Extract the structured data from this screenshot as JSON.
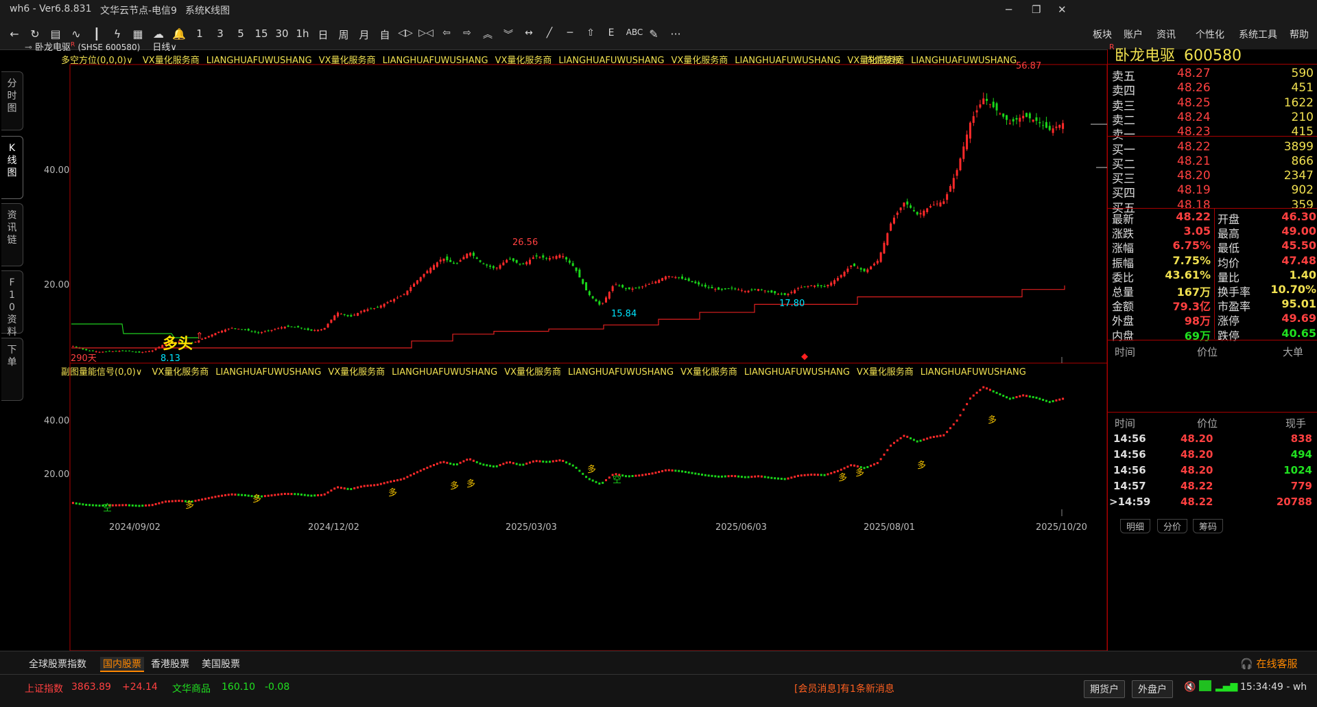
{
  "title_bar": {
    "app": "wh6  -  Ver6.8.831",
    "server": "文华云节点-电信9",
    "view": "系统K线图"
  },
  "toolbar": {
    "icons": [
      "back-icon",
      "refresh-icon",
      "list-icon",
      "line-chart-icon",
      "candlestick-icon",
      "lightning-icon",
      "grid-icon",
      "cloud-icon",
      "bell-icon"
    ],
    "periods": [
      "1",
      "3",
      "5",
      "15",
      "30",
      "1h",
      "日",
      "周",
      "月",
      "自"
    ],
    "right_menu": [
      "板块",
      "账户",
      "资讯",
      "个性化",
      "系统工具",
      "帮助"
    ],
    "draw_icons": [
      "compress-icon",
      "expand-icon",
      "left-arrow-icon",
      "right-arrow-icon",
      "up-double-icon",
      "down-double-icon",
      "fit-icon",
      "line-draw-icon",
      "hline-icon",
      "home-icon",
      "text-e-icon"
    ],
    "abc_label": "ABC",
    "more_label": "···"
  },
  "left_tabs": [
    {
      "label": "分时图",
      "active": false
    },
    {
      "label": "K线图",
      "active": true
    },
    {
      "label": "资讯链",
      "active": false
    },
    {
      "label": "F10资料",
      "active": false
    },
    {
      "label": "下单",
      "active": false
    }
  ],
  "chart_header": {
    "symbol": "卧龙电驱",
    "r_mark": "R",
    "code": "(SHSE 600580)",
    "period": "日线∨"
  },
  "main_panel": {
    "indicator": "多空方位(0,0,0)∨",
    "ads": [
      "VX量化服务商",
      "LIANGHUAFUWUSHANG",
      "VX量化服务商",
      "LIANGHUAFUWUSHANG",
      "VX量化服务商",
      "LIANGHUAFUWUSHANG",
      "VX量化服务商",
      "LIANGHUAFUWUSHANG",
      "VX量化服务商",
      "LIANGHUAFUWUSHANG"
    ],
    "adjust": "向前复权",
    "y_ticks": [
      "40.00",
      "20.00"
    ],
    "annotations": {
      "high": "56.87",
      "mid_high": "26.56",
      "low1": "8.13",
      "low2": "15.84",
      "low3": "17.80",
      "days": "290天",
      "signal": "多头"
    }
  },
  "sub_panel": {
    "indicator": "副图量能信号(0,0)∨",
    "ads": [
      "VX量化服务商",
      "LIANGHUAFUWUSHANG",
      "VX量化服务商",
      "LIANGHUAFUWUSHANG",
      "VX量化服务商",
      "LIANGHUAFUWUSHANG",
      "VX量化服务商",
      "LIANGHUAFUWUSHANG",
      "VX量化服务商",
      "LIANGHUAFUWUSHANG"
    ],
    "y_ticks": [
      "40.00",
      "20.00"
    ],
    "signals": {
      "bull": "多",
      "bear": "空"
    }
  },
  "x_axis": [
    "2024/09/02",
    "2024/12/02",
    "2025/03/03",
    "2025/06/03",
    "2025/08/01",
    "2025/10/20"
  ],
  "chart_data": {
    "type": "candlestick",
    "x_ticks": [
      "2024/09/02",
      "2024/12/02",
      "2025/03/03",
      "2025/06/03",
      "2025/08/01",
      "2025/10/20"
    ],
    "y_ticks": [
      20.0,
      40.0
    ],
    "labeled_points": [
      {
        "label": "8.13",
        "value": 8.13
      },
      {
        "label": "26.56",
        "value": 26.56
      },
      {
        "label": "15.84",
        "value": 15.84
      },
      {
        "label": "17.80",
        "value": 17.8
      },
      {
        "label": "56.87",
        "value": 56.87
      }
    ],
    "close_path": [
      9.3,
      8.6,
      8.3,
      8.4,
      8.5,
      8.2,
      8.5,
      9.8,
      10.1,
      9.8,
      10.8,
      11.8,
      12.5,
      12.2,
      11.6,
      12.1,
      12.7,
      12.6,
      12.0,
      12.3,
      15.2,
      14.4,
      15.6,
      16.0,
      17.2,
      18.2,
      20.6,
      22.8,
      24.7,
      23.5,
      25.8,
      23.7,
      22.8,
      24.6,
      23.4,
      25.0,
      24.6,
      25.3,
      23.0,
      18.5,
      16.3,
      20.2,
      19.2,
      19.6,
      20.4,
      21.6,
      21.2,
      20.4,
      19.6,
      19.1,
      19.4,
      18.9,
      19.3,
      18.6,
      18.2,
      19.5,
      19.9,
      19.7,
      21.3,
      23.5,
      22.3,
      24.3,
      31.0,
      34.5,
      32.2,
      33.8,
      34.6,
      40.2,
      48.5,
      52.6,
      50.4,
      48.2,
      49.5,
      48.6,
      47.0,
      48.22
    ],
    "current_price": 48.22
  },
  "quote": {
    "name": "卧龙电驱",
    "code": "600580",
    "asks": [
      {
        "label": "卖五",
        "price": "48.27",
        "vol": "590"
      },
      {
        "label": "卖四",
        "price": "48.26",
        "vol": "451"
      },
      {
        "label": "卖三",
        "price": "48.25",
        "vol": "1622"
      },
      {
        "label": "卖二",
        "price": "48.24",
        "vol": "210"
      },
      {
        "label": "卖一",
        "price": "48.23",
        "vol": "415"
      }
    ],
    "bids": [
      {
        "label": "买一",
        "price": "48.22",
        "vol": "3899"
      },
      {
        "label": "买二",
        "price": "48.21",
        "vol": "866"
      },
      {
        "label": "买三",
        "price": "48.20",
        "vol": "2347"
      },
      {
        "label": "买四",
        "price": "48.19",
        "vol": "902"
      },
      {
        "label": "买五",
        "price": "48.18",
        "vol": "359"
      }
    ],
    "stats_left": [
      {
        "label": "最新",
        "value": "48.22",
        "color": "red"
      },
      {
        "label": "涨跌",
        "value": "3.05",
        "color": "red"
      },
      {
        "label": "涨幅",
        "value": "6.75%",
        "color": "red"
      },
      {
        "label": "振幅",
        "value": "7.75%",
        "color": "yellow"
      },
      {
        "label": "委比",
        "value": "43.61%",
        "color": "yellow"
      },
      {
        "label": "总量",
        "value": "167万",
        "color": "yellow"
      },
      {
        "label": "金额",
        "value": "79.3亿",
        "color": "red"
      },
      {
        "label": "外盘",
        "value": "98万",
        "color": "red"
      },
      {
        "label": "内盘",
        "value": "69万",
        "color": "green"
      }
    ],
    "stats_right": [
      {
        "label": "开盘",
        "value": "46.30",
        "color": "red"
      },
      {
        "label": "最高",
        "value": "49.00",
        "color": "red"
      },
      {
        "label": "最低",
        "value": "45.50",
        "color": "red"
      },
      {
        "label": "均价",
        "value": "47.48",
        "color": "red"
      },
      {
        "label": "量比",
        "value": "1.40",
        "color": "yellow"
      },
      {
        "label": "换手率",
        "value": "10.70%",
        "color": "yellow"
      },
      {
        "label": "市盈率",
        "value": "95.01",
        "color": "yellow"
      },
      {
        "label": "涨停",
        "value": "49.69",
        "color": "red"
      },
      {
        "label": "跌停",
        "value": "40.65",
        "color": "green"
      }
    ],
    "big_header": [
      "时间",
      "价位",
      "大单"
    ],
    "tick_header": [
      "时间",
      "价位",
      "现手"
    ],
    "ticks": [
      {
        "time": "14:56",
        "price": "48.20",
        "vol": "838",
        "color": "red"
      },
      {
        "time": "14:56",
        "price": "48.20",
        "vol": "494",
        "color": "green"
      },
      {
        "time": "14:56",
        "price": "48.20",
        "vol": "1024",
        "color": "green"
      },
      {
        "time": "14:57",
        "price": "48.22",
        "vol": "779",
        "color": "red"
      },
      {
        "time": ">14:59",
        "price": "48.22",
        "vol": "20788",
        "color": "red"
      }
    ],
    "bottom_tabs": [
      "明细",
      "分价",
      "筹码"
    ]
  },
  "market_tabs": [
    "全球股票指数",
    "国内股票",
    "香港股票",
    "美国股票"
  ],
  "active_market_tab": "国内股票",
  "service": "在线客服",
  "status": {
    "index_name": "上证指数",
    "index_value": "3863.89",
    "index_change": "+24.14",
    "commodity_name": "文华商品",
    "commodity_value": "160.10",
    "commodity_change": "-0.08",
    "message": "[会员消息]有1条新消息",
    "btn_futures": "期货户",
    "btn_outer": "外盘户",
    "clock": "15:34:49 - wh"
  },
  "colors": {
    "up": "#ff3030",
    "down": "#20d020",
    "accent": "#f0e050",
    "border": "#b00000",
    "cyan": "#00e5ff"
  }
}
